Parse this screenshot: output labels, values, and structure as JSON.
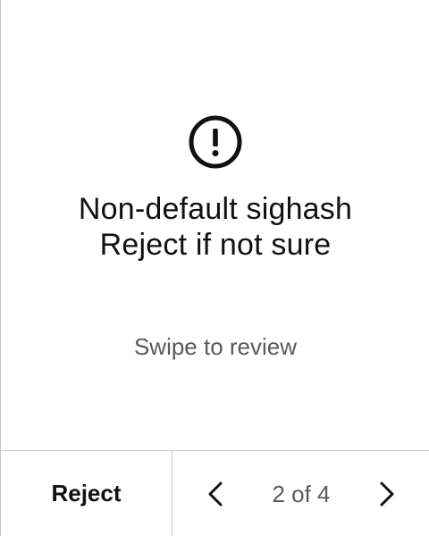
{
  "review": {
    "icon": "exclamation-circle-icon",
    "message_line1": "Non-default sighash",
    "message_line2": "Reject if not sure",
    "hint": "Swipe to review"
  },
  "footer": {
    "reject_label": "Reject",
    "prev_icon": "chevron-left-icon",
    "next_icon": "chevron-right-icon",
    "page_indicator": "2 of 4"
  },
  "colors": {
    "text": "#111111",
    "muted_text": "#5a5a5a",
    "divider": "#c8c8c8",
    "background": "#ffffff"
  }
}
